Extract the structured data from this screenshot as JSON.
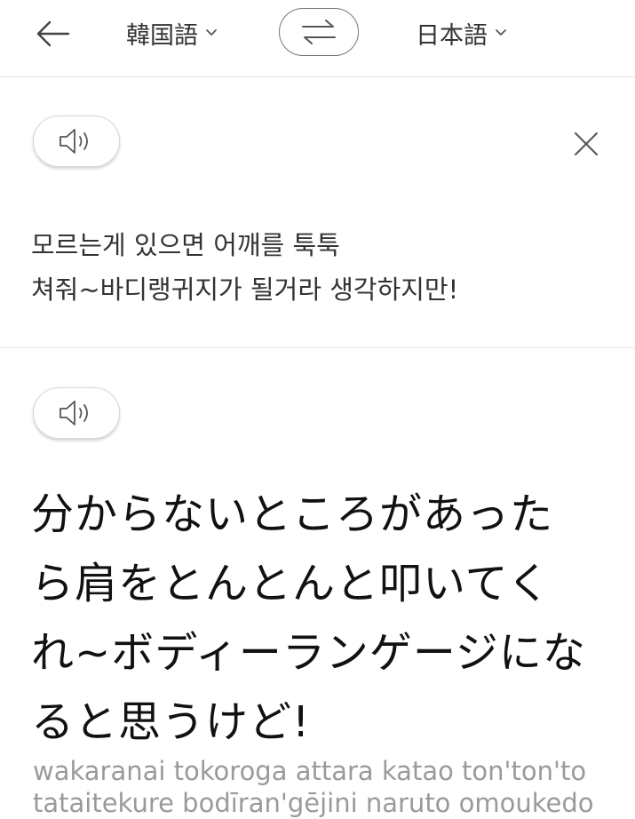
{
  "header": {
    "back_icon": "arrow-left-icon",
    "source_language": "韓国語",
    "target_language": "日本語",
    "swap_icon": "swap-arrows-icon",
    "chevron_icon": "chevron-down-icon"
  },
  "source": {
    "speaker_icon": "speaker-icon",
    "close_icon": "close-icon",
    "text": "모르는게 있으면 어깨를 툭툭\n쳐줘~바디랭귀지가 될거라 생각하지만!"
  },
  "translation": {
    "speaker_icon": "speaker-icon",
    "text": "分からないところがあった\nら肩をとんとんと叩いてく\nれ~ボディーランゲージにな\nると思うけど!",
    "romanization": "wakaranai tokoroga attara katao ton'ton'to\ntataitekure bodīran'gējini naruto omoukedo"
  }
}
